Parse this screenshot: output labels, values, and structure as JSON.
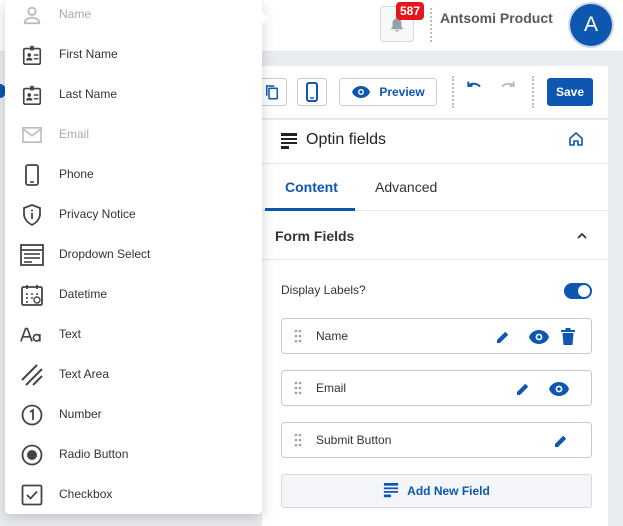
{
  "topbar": {
    "notification_count": "587",
    "product_name": "Antsomi Product",
    "avatar_letter": "A"
  },
  "toolbar": {
    "preview_label": "Preview",
    "save_label": "Save"
  },
  "panel": {
    "title": "Optin fields",
    "tabs": [
      "Content",
      "Advanced"
    ],
    "active_tab": "Content",
    "section_title": "Form Fields",
    "display_labels": "Display Labels?",
    "display_labels_on": true,
    "fields": [
      {
        "label": "Name",
        "actions": [
          "edit",
          "view",
          "delete"
        ]
      },
      {
        "label": "Email",
        "actions": [
          "edit",
          "view"
        ]
      },
      {
        "label": "Submit Button",
        "actions": [
          "edit"
        ]
      }
    ],
    "add_field_label": "Add New Field"
  },
  "menu": {
    "items": [
      {
        "label": "Name",
        "icon": "person-icon",
        "disabled": true
      },
      {
        "label": "First Name",
        "icon": "id-badge-icon",
        "disabled": false
      },
      {
        "label": "Last Name",
        "icon": "id-badge-icon",
        "disabled": false
      },
      {
        "label": "Email",
        "icon": "mail-icon",
        "disabled": true
      },
      {
        "label": "Phone",
        "icon": "phone-icon",
        "disabled": false
      },
      {
        "label": "Privacy Notice",
        "icon": "shield-info-icon",
        "disabled": false
      },
      {
        "label": "Dropdown Select",
        "icon": "dropdown-window-icon",
        "disabled": false
      },
      {
        "label": "Datetime",
        "icon": "calendar-icon",
        "disabled": false
      },
      {
        "label": "Text",
        "icon": "text-aa-icon",
        "disabled": false
      },
      {
        "label": "Text Area",
        "icon": "text-area-icon",
        "disabled": false
      },
      {
        "label": "Number",
        "icon": "number-one-icon",
        "disabled": false
      },
      {
        "label": "Radio Button",
        "icon": "radio-icon",
        "disabled": false
      },
      {
        "label": "Checkbox",
        "icon": "checkbox-icon",
        "disabled": false
      }
    ]
  },
  "colors": {
    "primary": "#0d57b0",
    "badge": "#e4151c"
  }
}
